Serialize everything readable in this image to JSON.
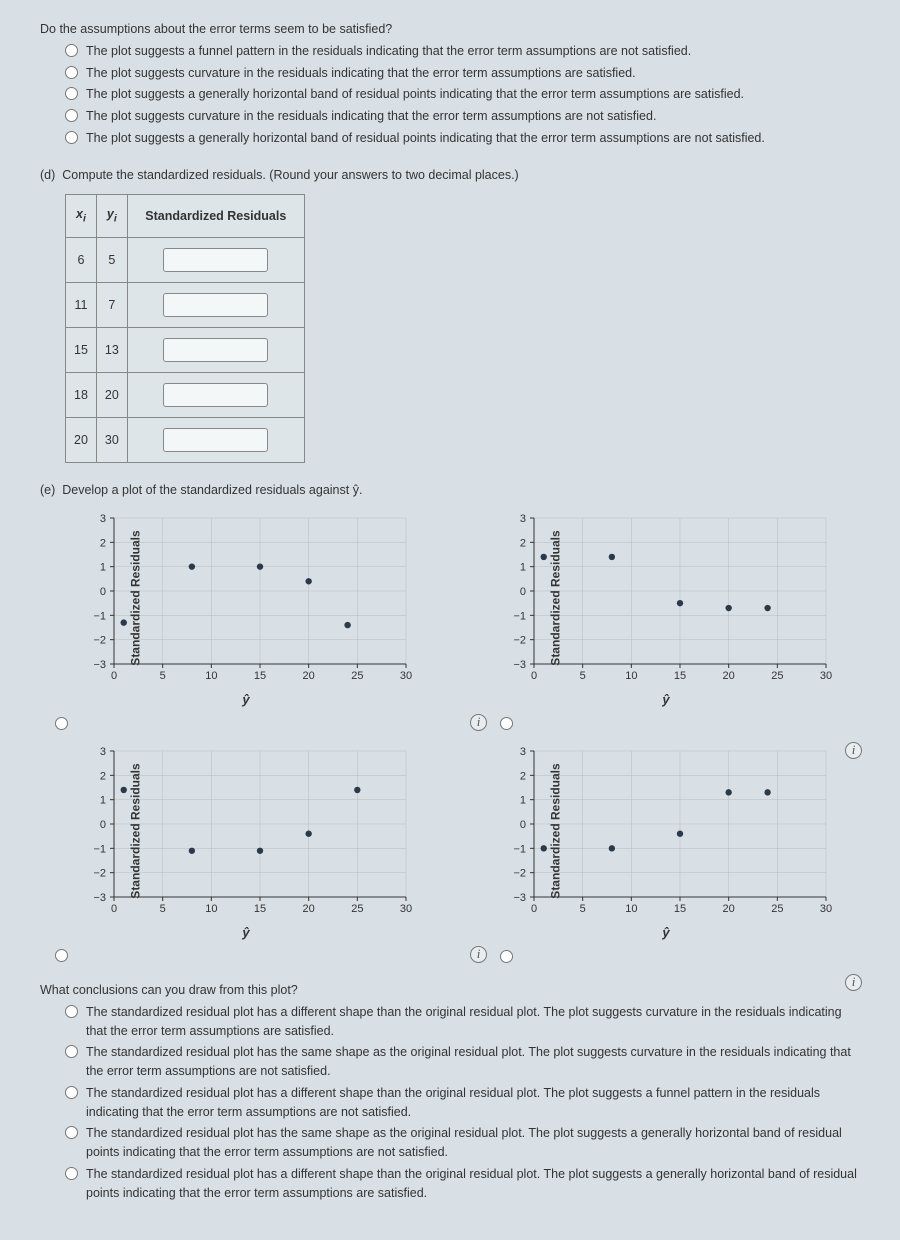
{
  "q1": {
    "prompt": "Do the assumptions about the error terms seem to be satisfied?",
    "opts": [
      "The plot suggests a funnel pattern in the residuals indicating that the error term assumptions are not satisfied.",
      "The plot suggests curvature in the residuals indicating that the error term assumptions are satisfied.",
      "The plot suggests a generally horizontal band of residual points indicating that the error term assumptions are satisfied.",
      "The plot suggests curvature in the residuals indicating that the error term assumptions are not satisfied.",
      "The plot suggests a generally horizontal band of residual points indicating that the error term assumptions are not satisfied."
    ]
  },
  "d": {
    "label": "(d)",
    "prompt": "Compute the standardized residuals. (Round your answers to two decimal places.)",
    "headers": {
      "x": "x",
      "xi": "i",
      "y": "y",
      "yi": "i",
      "sr": "Standardized Residuals"
    },
    "rows": [
      {
        "x": "6",
        "y": "5"
      },
      {
        "x": "11",
        "y": "7"
      },
      {
        "x": "15",
        "y": "13"
      },
      {
        "x": "18",
        "y": "20"
      },
      {
        "x": "20",
        "y": "30"
      }
    ]
  },
  "e": {
    "label": "(e)",
    "prompt": "Develop a plot of the standardized residuals against ŷ."
  },
  "q2": {
    "prompt": "What conclusions can you draw from this plot?",
    "opts": [
      "The standardized residual plot has a different shape than the original residual plot. The plot suggests curvature in the residuals indicating that the error term assumptions are satisfied.",
      "The standardized residual plot has the same shape as the original residual plot. The plot suggests curvature in the residuals indicating that the error term assumptions are not satisfied.",
      "The standardized residual plot has a different shape than the original residual plot. The plot suggests a funnel pattern in the residuals indicating that the error term assumptions are not satisfied.",
      "The standardized residual plot has the same shape as the original residual plot. The plot suggests a generally horizontal band of residual points indicating that the error term assumptions are not satisfied.",
      "The standardized residual plot has a different shape than the original residual plot. The plot suggests a generally horizontal band of residual points indicating that the error term assumptions are satisfied."
    ]
  },
  "chart_data": [
    {
      "type": "scatter",
      "xlabel": "ŷ",
      "ylabel": "Standardized Residuals",
      "xlim": [
        0,
        30
      ],
      "ylim": [
        -3,
        3
      ],
      "xticks": [
        0,
        5,
        10,
        15,
        20,
        25,
        30
      ],
      "yticks": [
        -3,
        -2,
        -1,
        0,
        1,
        2,
        3
      ],
      "points": [
        [
          1,
          -1.3
        ],
        [
          8,
          1.0
        ],
        [
          15,
          1.0
        ],
        [
          20,
          0.4
        ],
        [
          24,
          -1.4
        ]
      ]
    },
    {
      "type": "scatter",
      "xlabel": "ŷ",
      "ylabel": "Standardized Residuals",
      "xlim": [
        0,
        30
      ],
      "ylim": [
        -3,
        3
      ],
      "xticks": [
        0,
        5,
        10,
        15,
        20,
        25,
        30
      ],
      "yticks": [
        -3,
        -2,
        -1,
        0,
        1,
        2,
        3
      ],
      "points": [
        [
          1,
          1.4
        ],
        [
          8,
          1.4
        ],
        [
          15,
          -0.5
        ],
        [
          20,
          -0.7
        ],
        [
          24,
          -0.7
        ]
      ]
    },
    {
      "type": "scatter",
      "xlabel": "ŷ",
      "ylabel": "Standardized Residuals",
      "xlim": [
        0,
        30
      ],
      "ylim": [
        -3,
        3
      ],
      "xticks": [
        0,
        5,
        10,
        15,
        20,
        25,
        30
      ],
      "yticks": [
        -3,
        -2,
        -1,
        0,
        1,
        2,
        3
      ],
      "points": [
        [
          1,
          1.4
        ],
        [
          8,
          -1.1
        ],
        [
          15,
          -1.1
        ],
        [
          20,
          -0.4
        ],
        [
          25,
          1.4
        ]
      ]
    },
    {
      "type": "scatter",
      "xlabel": "ŷ",
      "ylabel": "Standardized Residuals",
      "xlim": [
        0,
        30
      ],
      "ylim": [
        -3,
        3
      ],
      "xticks": [
        0,
        5,
        10,
        15,
        20,
        25,
        30
      ],
      "yticks": [
        -3,
        -2,
        -1,
        0,
        1,
        2,
        3
      ],
      "points": [
        [
          1,
          -1.0
        ],
        [
          8,
          -1.0
        ],
        [
          15,
          -0.4
        ],
        [
          20,
          1.3
        ],
        [
          24,
          1.3
        ]
      ]
    }
  ]
}
